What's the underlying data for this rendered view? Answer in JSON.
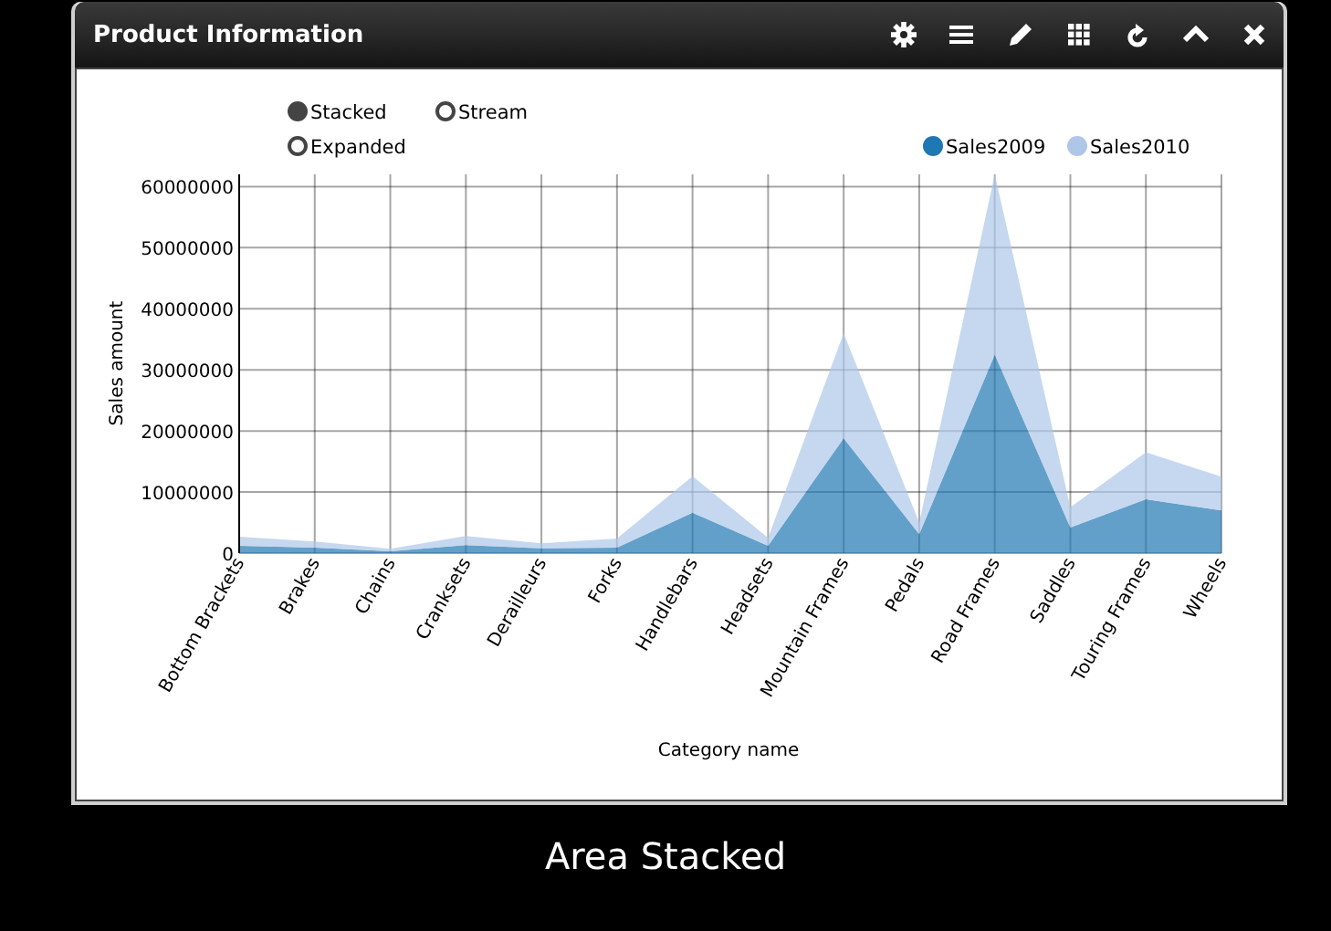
{
  "panel": {
    "title": "Product Information",
    "tools": [
      {
        "kind": "settings"
      },
      {
        "kind": "list"
      },
      {
        "kind": "edit"
      },
      {
        "kind": "grid"
      },
      {
        "kind": "refresh"
      },
      {
        "kind": "collapse"
      },
      {
        "kind": "close"
      }
    ]
  },
  "modes": [
    {
      "label": "Stacked",
      "selected": true
    },
    {
      "label": "Stream",
      "selected": false
    },
    {
      "label": "Expanded",
      "selected": false
    }
  ],
  "chart_data": {
    "type": "area",
    "stacked": true,
    "xlabel": "Category name",
    "ylabel": "Sales amount",
    "categories": [
      "Bottom Brackets",
      "Brakes",
      "Chains",
      "Cranksets",
      "Derailleurs",
      "Forks",
      "Handlebars",
      "Headsets",
      "Mountain Frames",
      "Pedals",
      "Road Frames",
      "Saddles",
      "Touring Frames",
      "Wheels"
    ],
    "series": [
      {
        "name": "Sales2009",
        "color": "#1f77b4",
        "values": [
          1200000,
          900000,
          300000,
          1300000,
          800000,
          900000,
          6600000,
          1200000,
          18800000,
          3100000,
          32500000,
          4200000,
          8800000,
          7000000
        ]
      },
      {
        "name": "Sales2010",
        "color": "#aec7e8",
        "values": [
          1500000,
          1000000,
          400000,
          1500000,
          800000,
          1500000,
          6000000,
          1300000,
          17200000,
          1900000,
          29500000,
          3300000,
          7700000,
          5500000
        ]
      }
    ],
    "ylim": [
      0,
      62000000
    ],
    "grid": true,
    "legend": true,
    "yticks": [
      {
        "value": 0,
        "label": "0"
      },
      {
        "value": 10000000,
        "label": "10000000"
      },
      {
        "value": 20000000,
        "label": "20000000"
      },
      {
        "value": 30000000,
        "label": "30000000"
      },
      {
        "value": 40000000,
        "label": "40000000"
      },
      {
        "value": 50000000,
        "label": "50000000"
      },
      {
        "value": 60000000,
        "label": "60000000"
      }
    ]
  },
  "caption": "Area Stacked"
}
